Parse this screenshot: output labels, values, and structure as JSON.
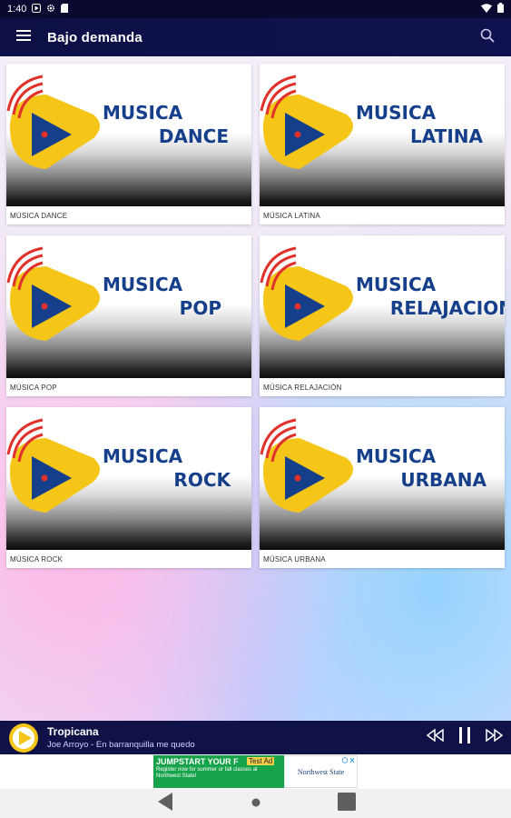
{
  "status_bar": {
    "time": "1:40",
    "icons": [
      "play-store-icon",
      "gear-icon",
      "sd-card-icon",
      "wifi-icon",
      "battery-icon"
    ]
  },
  "app_bar": {
    "title": "Bajo demanda",
    "menu_icon": "hamburger-menu-icon",
    "search_icon": "search-icon"
  },
  "categories": [
    {
      "word1": "MUSICA",
      "word2": "DANCE",
      "caption": "MÚSICA DANCE"
    },
    {
      "word1": "MUSICA",
      "word2": "LATINA",
      "caption": "MÚSICA LATINA"
    },
    {
      "word1": "MUSICA",
      "word2": "POP",
      "caption": "MÚSICA POP"
    },
    {
      "word1": "MUSICA",
      "word2": "RELAJACION",
      "caption": "MÚSICA RELAJACIÓN"
    },
    {
      "word1": "MUSICA",
      "word2": "ROCK",
      "caption": "MÚSICA ROCK"
    },
    {
      "word1": "MUSICA",
      "word2": "URBANA",
      "caption": "MÚSICA URBANA"
    }
  ],
  "player": {
    "station": "Tropicana",
    "track": "Joe Arroyo - En barranquilla me quedo",
    "controls": [
      "rewind-icon",
      "pause-icon",
      "fast-forward-icon"
    ]
  },
  "ad": {
    "headline": "JUMPSTART YOUR F",
    "tag": "Test Ad",
    "subtext": "Register now for summer or fall classes at Northwest State!",
    "brand": "Northwest State",
    "info_icon": "ad-info-icon"
  },
  "colors": {
    "app_bar_bg": "#0d0f46",
    "accent_yellow": "#f5c518",
    "logo_blue": "#153f8a",
    "logo_red": "#e0312a"
  }
}
